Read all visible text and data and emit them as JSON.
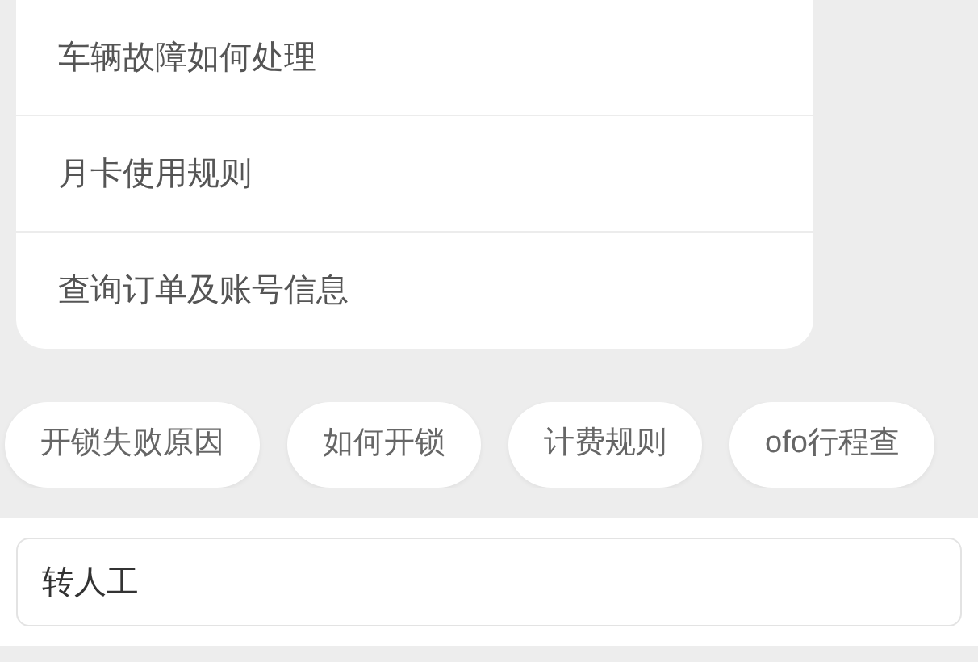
{
  "faq_list": {
    "items": [
      {
        "label": "车辆故障如何处理"
      },
      {
        "label": "月卡使用规则"
      },
      {
        "label": "查询订单及账号信息"
      }
    ]
  },
  "quick_chips": [
    {
      "label": "开锁失败原因"
    },
    {
      "label": "如何开锁"
    },
    {
      "label": "计费规则"
    },
    {
      "label": "ofo行程查"
    }
  ],
  "input_bar": {
    "value": "转人工"
  }
}
